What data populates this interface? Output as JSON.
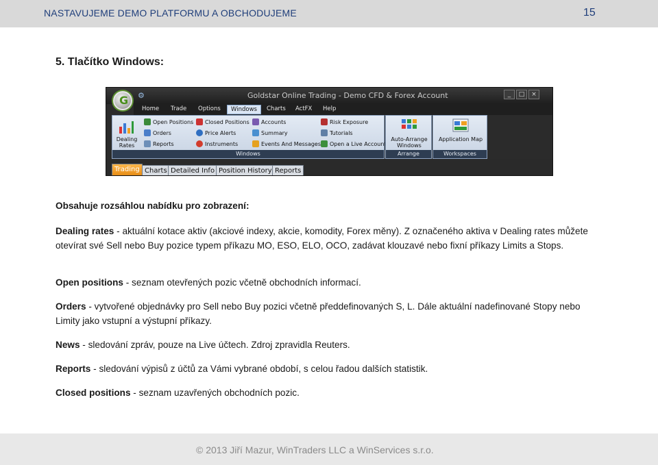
{
  "header": {
    "title": "NASTAVUJEME DEMO PLATFORMU A OBCHODUJEME",
    "page_number": "15"
  },
  "section": {
    "heading": "5.   Tlačítko Windows:"
  },
  "screenshot": {
    "window_title": "Goldstar Online Trading - Demo CFD & Forex Account",
    "logo_letter": "G",
    "window_buttons": [
      "_",
      "□",
      "×"
    ],
    "menu": [
      "Home",
      "Trade",
      "Options",
      "Windows",
      "Charts",
      "ActFX",
      "Help"
    ],
    "active_menu": "Windows",
    "windows_group": {
      "big_button": "Dealing Rates",
      "col1": [
        "Open Positions",
        "Orders",
        "Reports"
      ],
      "col2": [
        "Closed Positions",
        "Price Alerts",
        "Instruments"
      ],
      "col3": [
        "Accounts",
        "Summary",
        "Events And Messages"
      ],
      "col4": [
        "Risk Exposure",
        "Tutorials",
        "Open a Live Account"
      ],
      "label": "Windows"
    },
    "arrange_group": {
      "button": "Auto-Arrange Windows",
      "label": "Arrange Windows"
    },
    "workspaces_group": {
      "button": "Application Map",
      "label": "Workspaces"
    },
    "bottom_tabs": [
      "Trading",
      "Charts",
      "Detailed Info",
      "Position History",
      "Reports"
    ],
    "active_tab": "Trading"
  },
  "content": {
    "intro": "Obsahuje rozsáhlou nabídku pro zobrazení:",
    "items": [
      {
        "term": "Dealing rates",
        "text": " - aktuální kotace aktiv (akciové indexy, akcie, komodity, Forex měny). Z označeného aktiva v Dealing rates můžete otevírat své Sell nebo Buy pozice typem příkazu MO, ESO, ELO, OCO, zadávat klouzavé nebo fixní příkazy Limits a Stops."
      },
      {
        "term": "Open positions",
        "text": " - seznam otevřených pozic včetně obchodních informací."
      },
      {
        "term": "Orders",
        "text": " - vytvořené objednávky pro Sell nebo Buy pozici včetně předdefinovaných S, L. Dále aktuální nadefinované Stopy nebo Limity jako vstupní a výstupní příkazy."
      },
      {
        "term": "News",
        "text": " - sledování zpráv, pouze na Live účtech. Zdroj zpravidla Reuters."
      },
      {
        "term": "Reports",
        "text": " - sledování výpisů z účtů za Vámi vybrané období, s celou řadou dalších statistik."
      },
      {
        "term": "Closed positions",
        "text": " - seznam uzavřených obchodních pozic."
      }
    ]
  },
  "footer": {
    "text": "© 2013 Jiří Mazur, WinTraders LLC a WinServices s.r.o."
  },
  "colors": {
    "header_text": "#1f3e7a",
    "active_tab": "#f29a1f",
    "ribbon": "#c7d3e3"
  }
}
